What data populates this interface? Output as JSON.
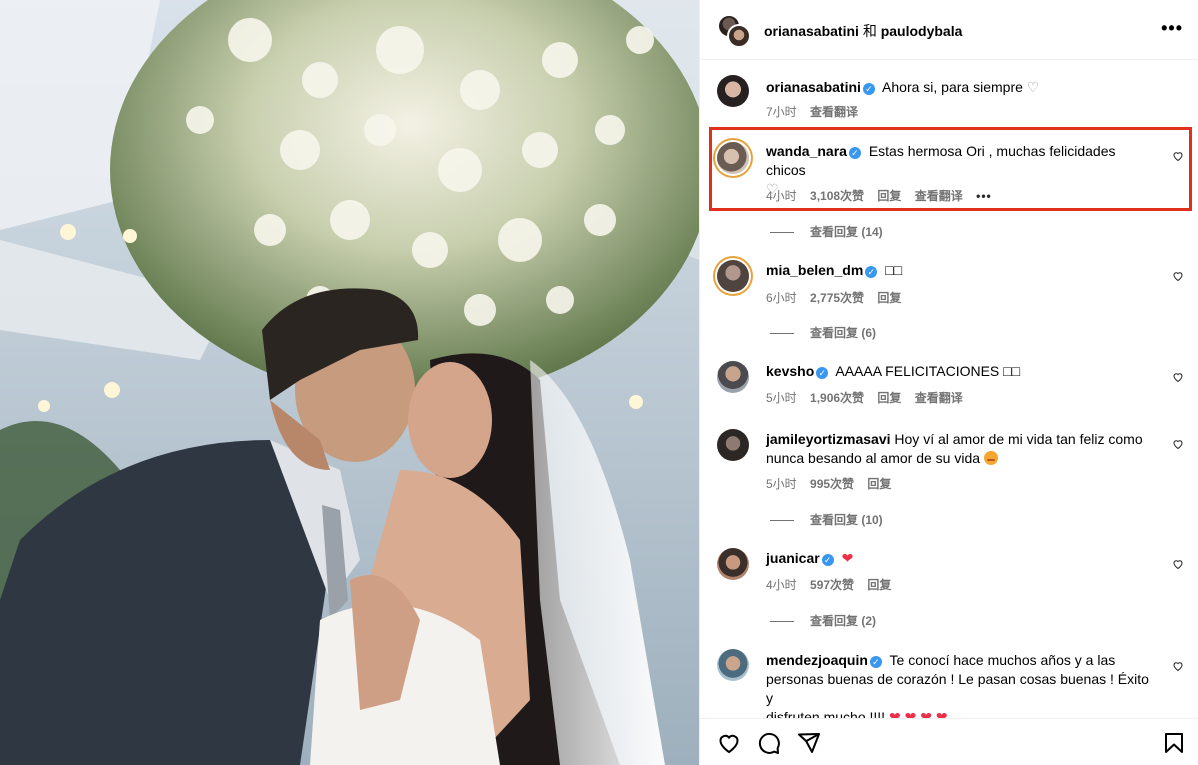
{
  "post": {
    "header": {
      "author_1": "orianasabatini",
      "joiner": "和",
      "author_2": "paulodybala",
      "more_icon": "more-horizontal-icon"
    }
  },
  "comments": [
    {
      "user": "orianasabatini",
      "verified": true,
      "text": "Ahora si, para siempre",
      "trailing_emoji": "white-heart-icon",
      "time": "7小时",
      "likes": "",
      "reply": "",
      "translate": "查看翻译"
    },
    {
      "user": "wanda_nara",
      "verified": true,
      "text": "Estas hermosa Ori , muchas felicidades chicos",
      "trailing_emoji": "white-heart-icon",
      "time": "4小时",
      "likes": "3,108次赞",
      "reply": "回复",
      "translate": "查看翻译",
      "replies": "查看回复 (14)",
      "highlighted": true
    },
    {
      "user": "mia_belen_dm",
      "verified": true,
      "text": "□□",
      "time": "6小时",
      "likes": "2,775次赞",
      "reply": "回复",
      "replies": "查看回复 (6)"
    },
    {
      "user": "kevsho",
      "verified": true,
      "text": "AAAAA FELICITACIONES □□",
      "time": "5小时",
      "likes": "1,906次赞",
      "reply": "回复",
      "translate": "查看翻译"
    },
    {
      "user": "jamileyortizmasavi",
      "verified": false,
      "text_line1": "Hoy ví al amor de mi vida tan feliz como",
      "text_line2": "nunca besando al amor de su vida",
      "time": "5小时",
      "likes": "995次赞",
      "reply": "回复",
      "replies": "查看回复 (10)"
    },
    {
      "user": "juanicar",
      "verified": true,
      "text": "❤",
      "time": "4小时",
      "likes": "597次赞",
      "reply": "回复",
      "replies": "查看回复 (2)"
    },
    {
      "user": "mendezjoaquin",
      "verified": true,
      "text_line1": "Te conocí hace muchos años y a las",
      "text_line2": "personas buenas de corazón ! Le pasan cosas buenas ! Éxito y",
      "text_line3": "disfruten mucho !!!!",
      "hearts": "❤ ❤ ❤ ❤"
    }
  ],
  "actions": {
    "like_icon": "heart-icon",
    "comment_icon": "comment-icon",
    "share_icon": "send-icon",
    "save_icon": "bookmark-icon"
  }
}
